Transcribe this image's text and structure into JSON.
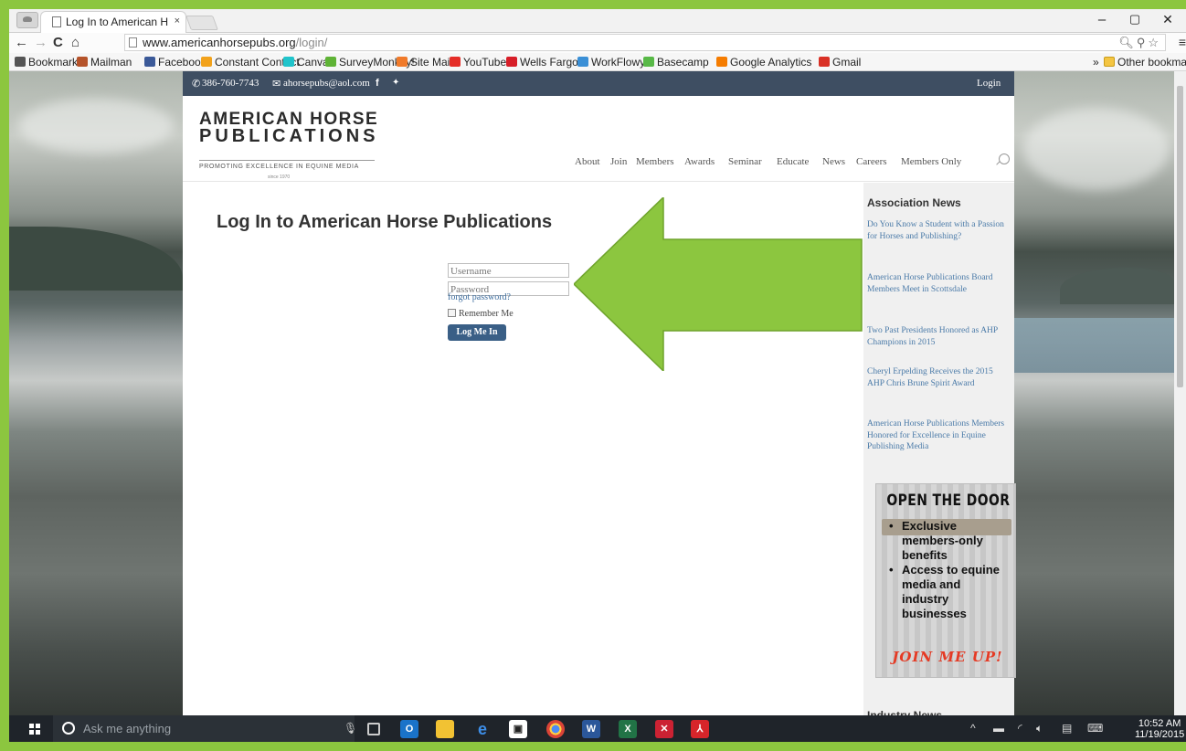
{
  "browser": {
    "tab_title": "Log In to American H",
    "tab_close": "×",
    "url_host": "www.americanhorsepubs.org",
    "url_path": "/login/",
    "win_min": "–",
    "win_max": "▢",
    "win_close": "✕",
    "bookmarks": [
      {
        "label": "Bookmarks",
        "icon": "star-icon",
        "color": "#555555"
      },
      {
        "label": "Mailman",
        "icon": "mailman-icon",
        "color": "#b5532a"
      },
      {
        "label": "Facebook",
        "icon": "facebook-icon",
        "color": "#3b5998"
      },
      {
        "label": "Constant Contact",
        "icon": "constant-contact-icon",
        "color": "#f2a21b"
      },
      {
        "label": "Canva",
        "icon": "canva-icon",
        "color": "#20c4cb"
      },
      {
        "label": "SurveyMonkey!",
        "icon": "surveymonkey-icon",
        "color": "#5fb336"
      },
      {
        "label": "Site Mail",
        "icon": "site-mail-icon",
        "color": "#f07a2a"
      },
      {
        "label": "YouTube",
        "icon": "youtube-icon",
        "color": "#e52d27"
      },
      {
        "label": "Wells Fargo",
        "icon": "wells-fargo-icon",
        "color": "#d71e28"
      },
      {
        "label": "WorkFlowy",
        "icon": "workflowy-icon",
        "color": "#3a8fd6"
      },
      {
        "label": "Basecamp",
        "icon": "basecamp-icon",
        "color": "#58b947"
      },
      {
        "label": "Google Analytics",
        "icon": "google-analytics-icon",
        "color": "#f57c00"
      },
      {
        "label": "Gmail",
        "icon": "gmail-icon",
        "color": "#d93025"
      }
    ],
    "other_bookmarks": "Other bookmarks",
    "overflow": "»"
  },
  "site": {
    "phone": "386-760-7743",
    "email": "ahorsepubs@aol.com",
    "login_link": "Login",
    "logo_line1": "AMERICAN HORSE",
    "logo_line2": "PUBLICATIONS",
    "logo_tagline": "PROMOTING EXCELLENCE IN EQUINE MEDIA",
    "logo_since": "since 1970",
    "nav": [
      "About",
      "Join",
      "Members",
      "Awards",
      "Seminar",
      "Educate",
      "News",
      "Careers",
      "Members Only"
    ],
    "page_title": "Log In to American Horse Publications",
    "username_placeholder": "Username",
    "password_placeholder": "Password",
    "forgot": "forgot password?",
    "remember": "Remember Me",
    "login_button": "Log Me In",
    "sidebar_title": "Association News",
    "news": [
      "Do You Know a Student with a Passion for Horses and Publishing?",
      "American Horse Publications Board Members Meet in Scottsdale",
      "Two Past Presidents Honored as AHP Champions in 2015",
      "Cheryl Erpelding Receives the 2015 AHP Chris Brune Spirit Award",
      "American Horse Publications Members Honored for Excellence in Equine Publishing Media"
    ],
    "promo_heading": "OPEN THE DOOR",
    "promo_items": [
      "Exclusive members-only benefits",
      "Access to equine media and industry businesses"
    ],
    "promo_cta": "JOIN ME UP!",
    "industry_title": "Industry News",
    "arrow_color": "#8cc63f"
  },
  "taskbar": {
    "search_placeholder": "Ask me anything",
    "time": "10:52 AM",
    "date": "11/19/2015"
  }
}
